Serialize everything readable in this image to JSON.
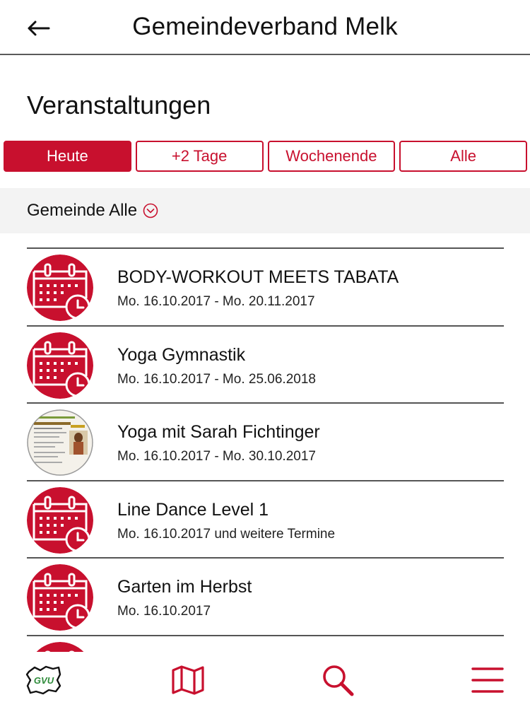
{
  "header": {
    "title": "Gemeindeverband Melk"
  },
  "section": {
    "title": "Veranstaltungen"
  },
  "filters": [
    {
      "label": "Heute",
      "active": true
    },
    {
      "label": "+2 Tage",
      "active": false
    },
    {
      "label": "Wochenende",
      "active": false
    },
    {
      "label": "Alle",
      "active": false
    }
  ],
  "gemeinde": {
    "label": "Gemeinde Alle"
  },
  "events": [
    {
      "title": "BODY-WORKOUT MEETS TABATA",
      "date": "Mo. 16.10.2017 - Mo. 20.11.2017",
      "thumb": "calendar-clock-icon"
    },
    {
      "title": "Yoga Gymnastik",
      "date": "Mo. 16.10.2017 - Mo. 25.06.2018",
      "thumb": "calendar-clock-icon"
    },
    {
      "title": "Yoga mit Sarah Fichtinger",
      "date": "Mo. 16.10.2017 - Mo. 30.10.2017",
      "thumb": "event-flyer-image"
    },
    {
      "title": "Line Dance Level 1",
      "date": "Mo. 16.10.2017 und weitere Termine",
      "thumb": "calendar-clock-icon"
    },
    {
      "title": "Garten im Herbst",
      "date": "Mo. 16.10.2017",
      "thumb": "calendar-clock-icon"
    },
    {
      "title": "",
      "date": "",
      "thumb": "calendar-clock-icon"
    }
  ],
  "nav": {
    "logo_text": "GVU",
    "items": [
      "gvu-logo-icon",
      "map-icon",
      "search-icon",
      "menu-icon"
    ]
  },
  "colors": {
    "accent": "#c8102e",
    "divider": "#555555",
    "bar_bg": "#f3f3f3"
  }
}
